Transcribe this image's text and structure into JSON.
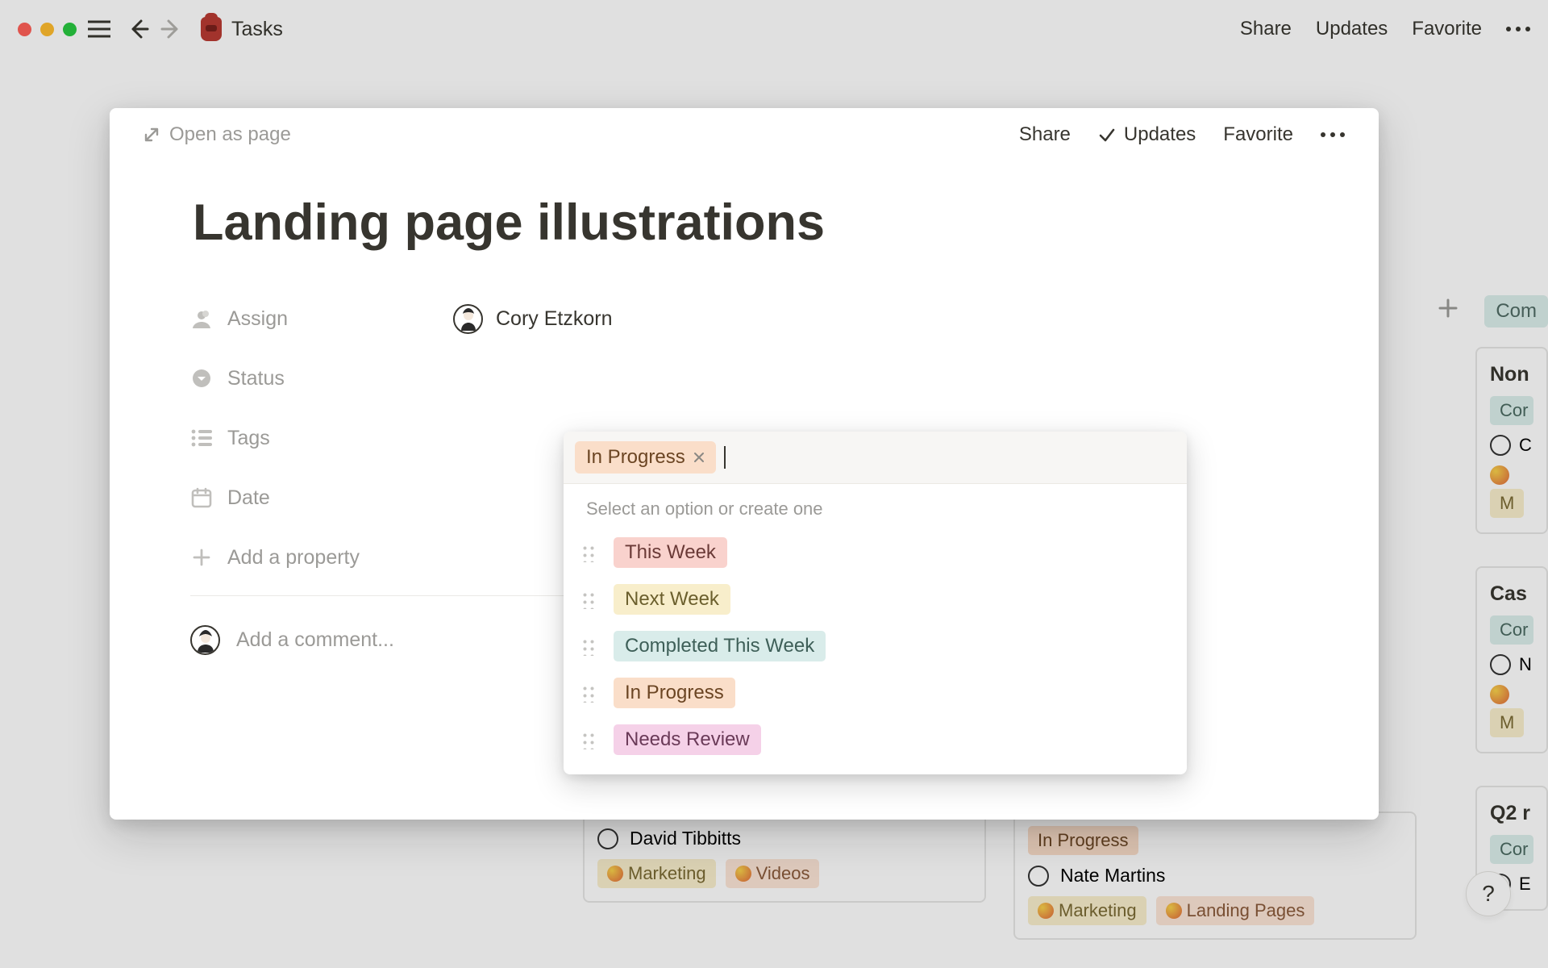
{
  "topbar": {
    "title": "Tasks",
    "actions": {
      "share": "Share",
      "updates": "Updates",
      "favorite": "Favorite"
    }
  },
  "bg": {
    "column_add": "+",
    "column_tag": "Com",
    "cards": [
      {
        "title": "Non",
        "status": "Cor",
        "tag": "M",
        "assignee_initial": "C"
      },
      {
        "title": "Cas",
        "status": "Cor",
        "tag": "M",
        "assignee_initial": "N"
      },
      {
        "title": "Q2 r",
        "status": "Cor",
        "tag": "",
        "assignee_initial": "E"
      }
    ],
    "bottom_left": {
      "assignee": "David Tibbitts",
      "tags": [
        "Marketing",
        "Videos"
      ]
    },
    "bottom_right": {
      "status": "In Progress",
      "assignee": "Nate Martins",
      "tags": [
        "Marketing",
        "Landing Pages"
      ]
    }
  },
  "modal": {
    "open_as_page": "Open as page",
    "actions": {
      "share": "Share",
      "updates": "Updates",
      "favorite": "Favorite"
    },
    "title": "Landing page illustrations",
    "properties": {
      "assign_label": "Assign",
      "assign_value": "Cory Etzkorn",
      "status_label": "Status",
      "tags_label": "Tags",
      "date_label": "Date",
      "add_property": "Add a property"
    },
    "comment_placeholder": "Add a comment..."
  },
  "select": {
    "selected": "In Progress",
    "hint": "Select an option or create one",
    "options": [
      {
        "label": "This Week",
        "cls": "c-thisweek"
      },
      {
        "label": "Next Week",
        "cls": "c-nextweek"
      },
      {
        "label": "Completed This Week",
        "cls": "c-completed"
      },
      {
        "label": "In Progress",
        "cls": "c-inprogress"
      },
      {
        "label": "Needs Review",
        "cls": "c-needs"
      }
    ]
  },
  "help": "?"
}
